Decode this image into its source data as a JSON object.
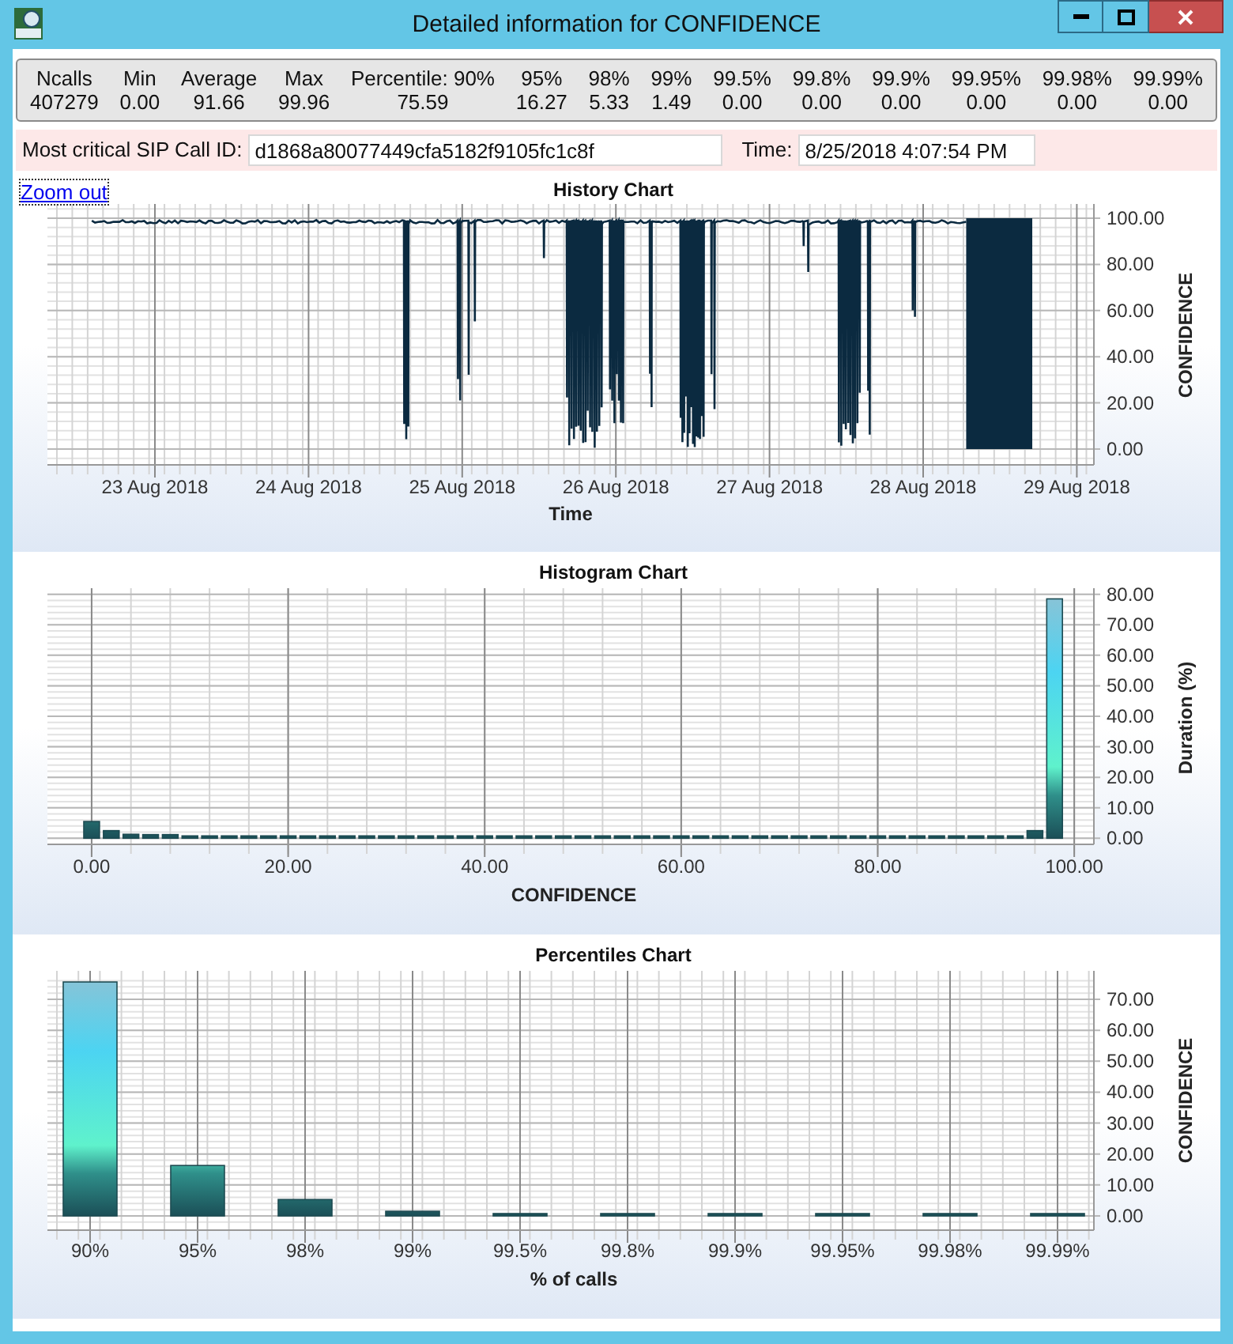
{
  "window": {
    "title": "Detailed information for CONFIDENCE"
  },
  "stats": {
    "columns": [
      {
        "header": "Ncalls",
        "value": "407279"
      },
      {
        "header": "Min",
        "value": "0.00"
      },
      {
        "header": "Average",
        "value": "91.66"
      },
      {
        "header": "Max",
        "value": "99.96"
      },
      {
        "header": "Percentile: 90%",
        "value": "75.59"
      },
      {
        "header": "95%",
        "value": "16.27"
      },
      {
        "header": "98%",
        "value": "5.33"
      },
      {
        "header": "99%",
        "value": "1.49"
      },
      {
        "header": "99.5%",
        "value": "0.00"
      },
      {
        "header": "99.8%",
        "value": "0.00"
      },
      {
        "header": "99.9%",
        "value": "0.00"
      },
      {
        "header": "99.95%",
        "value": "0.00"
      },
      {
        "header": "99.98%",
        "value": "0.00"
      },
      {
        "header": "99.99%",
        "value": "0.00"
      }
    ]
  },
  "critical_call": {
    "label": "Most critical SIP Call ID:",
    "call_id": "d1868a80077449cfa5182f9105fc1c8f",
    "time_label": "Time:",
    "time": "8/25/2018 4:07:54 PM"
  },
  "zoom_link": "Zoom out",
  "history_chart": {
    "title": "History Chart",
    "xlabel": "Time",
    "ylabel": "CONFIDENCE",
    "x_tick_labels": [
      "23 Aug 2018",
      "24 Aug 2018",
      "25 Aug 2018",
      "26 Aug 2018",
      "27 Aug 2018",
      "28 Aug 2018",
      "29 Aug 2018"
    ],
    "y_tick_labels": [
      "100.00",
      "80.00",
      "60.00",
      "40.00",
      "20.00",
      "0.00"
    ]
  },
  "histogram_chart": {
    "chart_data": {
      "type": "bar",
      "title": "Histogram Chart",
      "xlabel": "CONFIDENCE",
      "ylabel": "Duration (%)",
      "x": [
        0,
        2,
        4,
        6,
        8,
        10,
        12,
        14,
        16,
        18,
        20,
        22,
        24,
        26,
        28,
        30,
        32,
        34,
        36,
        38,
        40,
        42,
        44,
        46,
        48,
        50,
        52,
        54,
        56,
        58,
        60,
        62,
        64,
        66,
        68,
        70,
        72,
        74,
        76,
        78,
        80,
        82,
        84,
        86,
        88,
        90,
        92,
        94,
        96,
        98
      ],
      "values": [
        5.5,
        2.5,
        1.3,
        1.2,
        1.2,
        0.6,
        0.3,
        0.3,
        0.3,
        0.3,
        0.3,
        0.3,
        0.3,
        0.3,
        0.3,
        0.3,
        0.3,
        0.3,
        0.3,
        0.3,
        0.3,
        0.3,
        0.3,
        0.3,
        0.3,
        0.3,
        0.3,
        0.3,
        0.3,
        0.3,
        0.3,
        0.3,
        0.3,
        0.3,
        0.3,
        0.3,
        0.3,
        0.3,
        0.3,
        0.3,
        0.3,
        0.3,
        0.3,
        0.3,
        0.3,
        0.3,
        0.6,
        0.3,
        2.5,
        78.5
      ],
      "xlim": [
        -4.5,
        102
      ],
      "ylim": [
        -2,
        82
      ],
      "grid": true,
      "xticks": [
        {
          "value": 0,
          "label": "0.00"
        },
        {
          "value": 20,
          "label": "20.00"
        },
        {
          "value": 40,
          "label": "40.00"
        },
        {
          "value": 60,
          "label": "60.00"
        },
        {
          "value": 80,
          "label": "80.00"
        },
        {
          "value": 100,
          "label": "100.00"
        }
      ],
      "yticks": [
        {
          "value": 0,
          "label": "0.00"
        },
        {
          "value": 10,
          "label": "10.00"
        },
        {
          "value": 20,
          "label": "20.00"
        },
        {
          "value": 30,
          "label": "30.00"
        },
        {
          "value": 40,
          "label": "40.00"
        },
        {
          "value": 50,
          "label": "50.00"
        },
        {
          "value": 60,
          "label": "60.00"
        },
        {
          "value": 70,
          "label": "70.00"
        },
        {
          "value": 80,
          "label": "80.00"
        }
      ]
    }
  },
  "percentiles_chart": {
    "chart_data": {
      "type": "bar",
      "title": "Percentiles Chart",
      "xlabel": "% of calls",
      "ylabel": "CONFIDENCE",
      "categories": [
        "90%",
        "95%",
        "98%",
        "99%",
        "99.5%",
        "99.8%",
        "99.9%",
        "99.95%",
        "99.98%",
        "99.99%"
      ],
      "values": [
        75.6,
        16.3,
        5.3,
        1.5,
        0,
        0,
        0,
        0,
        0,
        0
      ],
      "ylim": [
        -2,
        78
      ],
      "grid": true,
      "yticks": [
        {
          "value": 0,
          "label": "0.00"
        },
        {
          "value": 10,
          "label": "10.00"
        },
        {
          "value": 20,
          "label": "20.00"
        },
        {
          "value": 30,
          "label": "30.00"
        },
        {
          "value": 40,
          "label": "40.00"
        },
        {
          "value": 50,
          "label": "50.00"
        },
        {
          "value": 60,
          "label": "60.00"
        },
        {
          "value": 70,
          "label": "70.00"
        }
      ]
    }
  }
}
